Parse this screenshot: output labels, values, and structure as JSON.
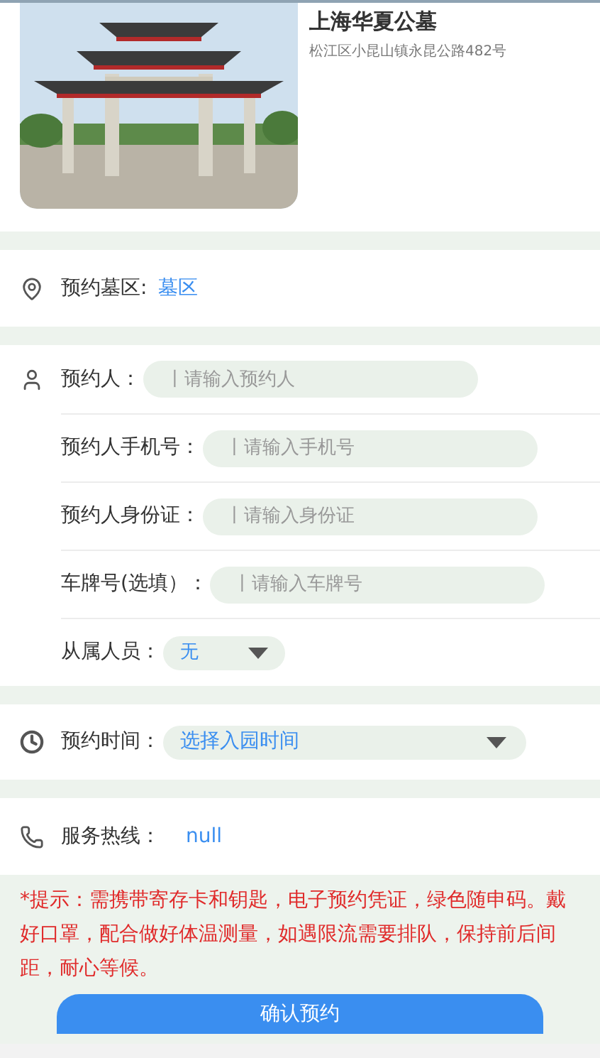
{
  "header": {
    "title": "上海华夏公墓",
    "address": "松江区小昆山镇永昆公路482号"
  },
  "area": {
    "label": "预约墓区:",
    "value": "墓区"
  },
  "person_fields": [
    {
      "kind": "input",
      "label": "预约人：",
      "placeholder": "丨请输入预约人",
      "icon": true
    },
    {
      "kind": "input",
      "label": "预约人手机号：",
      "placeholder": "丨请输入手机号",
      "icon": false
    },
    {
      "kind": "input",
      "label": "预约人身份证：",
      "placeholder": "丨请输入身份证",
      "icon": false
    },
    {
      "kind": "input",
      "label": "车牌号(选填）：",
      "placeholder": "丨请输入车牌号",
      "icon": false
    },
    {
      "kind": "select",
      "label": "从属人员：",
      "value": "无",
      "icon": false
    }
  ],
  "time": {
    "label": "预约时间：",
    "value": "选择入园时间"
  },
  "hotline": {
    "label": "服务热线：",
    "value": "null"
  },
  "notice": "*提示：需携带寄存卡和钥匙，电子预约凭证，绿色随申码。戴好口罩，配合做好体温测量，如遇限流需要排队，保持前后间距，耐心等候。",
  "submit_button": "确认预约"
}
